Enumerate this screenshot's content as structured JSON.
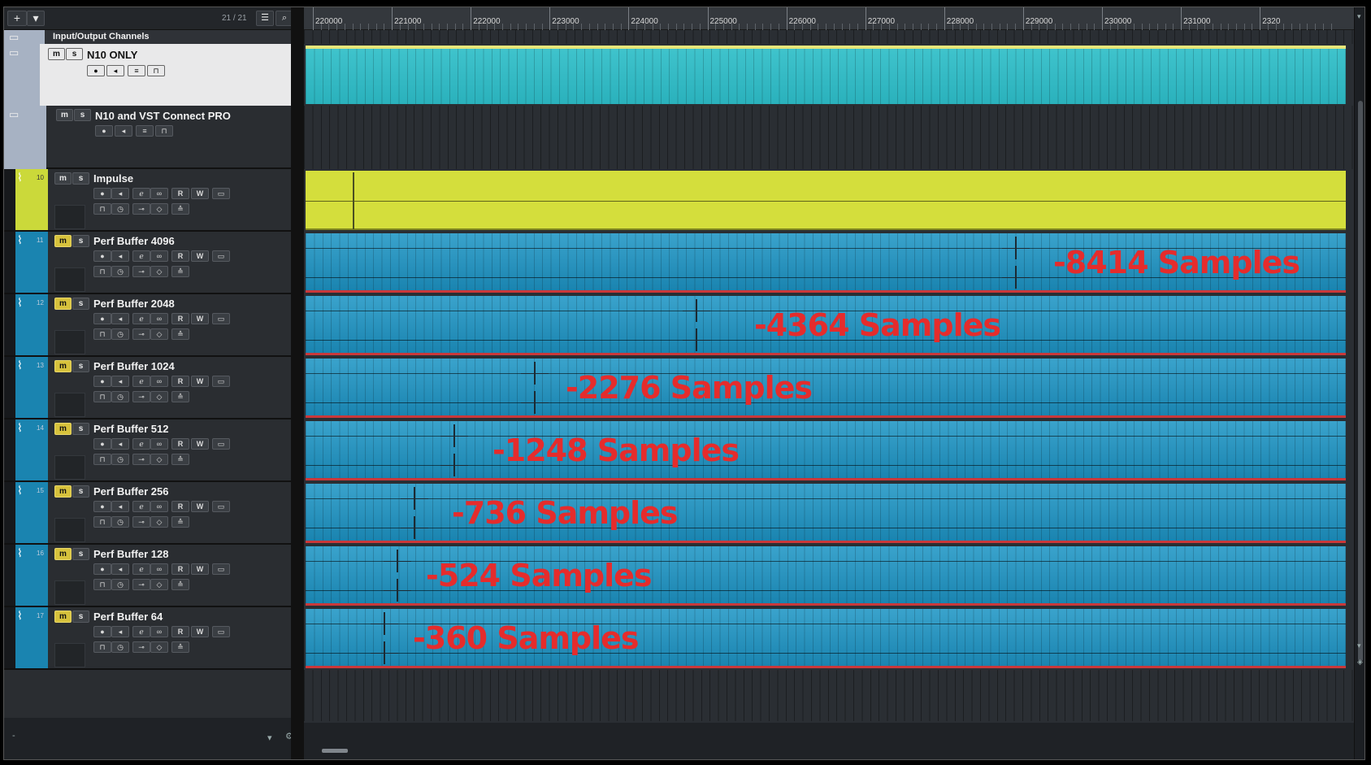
{
  "toolbar": {
    "add_label": "+",
    "dropdown_label": "▾",
    "track_count": "21 / 21",
    "list_icon": "list-icon",
    "search_icon": "search-icon"
  },
  "colors": {
    "accent_mute": "#d7c23c",
    "audio_track": "#1a84b0",
    "impulse": "#d4de3c",
    "latency_label": "#e52c2c"
  },
  "folders": [
    {
      "name": "Input/Output Channels"
    },
    {
      "name": "N10 ONLY",
      "mute": "m",
      "solo": "s"
    },
    {
      "name": "N10 and VST Connect PRO",
      "mute": "m",
      "solo": "s"
    }
  ],
  "tracks": [
    {
      "num": "10",
      "name": "Impulse",
      "mute": "m",
      "solo": "s",
      "r": "R",
      "w": "W"
    },
    {
      "num": "11",
      "name": "Perf Buffer 4096",
      "mute": "m",
      "solo": "s",
      "r": "R",
      "w": "W",
      "latency": "-8414 Samples"
    },
    {
      "num": "12",
      "name": "Perf Buffer 2048",
      "mute": "m",
      "solo": "s",
      "r": "R",
      "w": "W",
      "latency": "-4364 Samples"
    },
    {
      "num": "13",
      "name": "Perf Buffer 1024",
      "mute": "m",
      "solo": "s",
      "r": "R",
      "w": "W",
      "latency": "-2276 Samples"
    },
    {
      "num": "14",
      "name": "Perf Buffer 512",
      "mute": "m",
      "solo": "s",
      "r": "R",
      "w": "W",
      "latency": "-1248 Samples"
    },
    {
      "num": "15",
      "name": "Perf Buffer 256",
      "mute": "m",
      "solo": "s",
      "r": "R",
      "w": "W",
      "latency": "-736 Samples"
    },
    {
      "num": "16",
      "name": "Perf Buffer 128",
      "mute": "m",
      "solo": "s",
      "r": "R",
      "w": "W",
      "latency": "-524 Samples"
    },
    {
      "num": "17",
      "name": "Perf Buffer 64",
      "mute": "m",
      "solo": "s",
      "r": "R",
      "w": "W",
      "latency": "-360 Samples"
    }
  ],
  "ruler": {
    "labels": [
      "220000",
      "221000",
      "222000",
      "223000",
      "224000",
      "225000",
      "226000",
      "227000",
      "228000",
      "229000",
      "230000",
      "231000",
      "2320"
    ]
  }
}
